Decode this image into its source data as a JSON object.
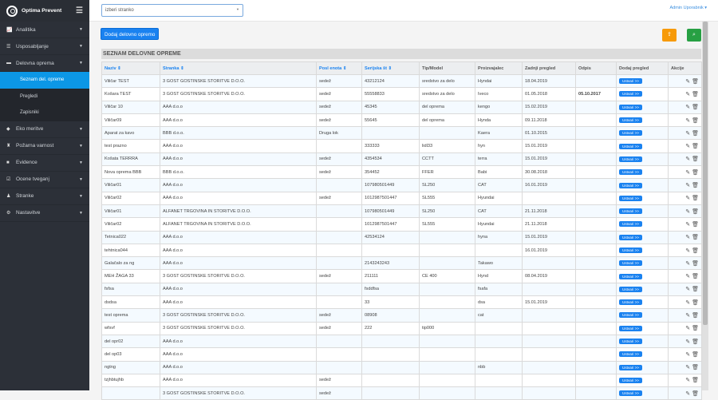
{
  "app": {
    "title": "Optima Prevent"
  },
  "sidebar": {
    "items": [
      {
        "label": "Analitika",
        "icon": "chart-icon",
        "glyph": "📈"
      },
      {
        "label": "Usposabljanje",
        "icon": "training-icon",
        "glyph": "☰"
      },
      {
        "label": "Delovna oprema",
        "icon": "truck-icon",
        "glyph": "▬"
      },
      {
        "label": "Eko meritve",
        "icon": "leaf-icon",
        "glyph": "◆"
      },
      {
        "label": "Požarna varnost",
        "icon": "fire-extinguisher-icon",
        "glyph": "♜"
      },
      {
        "label": "Evidence",
        "icon": "book-icon",
        "glyph": "■"
      },
      {
        "label": "Ocene tveganj",
        "icon": "checkbox-icon",
        "glyph": "☑"
      },
      {
        "label": "Stranke",
        "icon": "user-icon",
        "glyph": "♟"
      },
      {
        "label": "Nastavitve",
        "icon": "cogs-icon",
        "glyph": "⚙"
      }
    ],
    "sub": [
      "Seznam del. opreme",
      "Pregledi",
      "Zapisniki"
    ]
  },
  "topbar": {
    "select_value": "izberi stranko",
    "user": "Admin Uporabnik"
  },
  "main": {
    "add_button": "Dodaj delovno opremo",
    "section_title": "SEZNAM DELOVNE OPREME",
    "create_label": "Ustvari >>"
  },
  "table": {
    "columns": [
      "Naziv ⇕",
      "Stranka ⇕",
      "Posl enota ⇕",
      "Serijska št ⇕",
      "Tip/Model",
      "Proizvajalec",
      "Zadnji pregled",
      "Odpis",
      "Dodaj pregled",
      "Akcije"
    ],
    "rows": [
      [
        "Viličar TEST",
        "3 GOST GOSTINSKE STORITVE D.O.O.",
        "sedež",
        "43212124",
        "sredstvo za delo",
        "Hyndai",
        "18.04.2019",
        ""
      ],
      [
        "Košara TEST",
        "3 GOST GOSTINSKE STORITVE D.O.O.",
        "sedež",
        "55558833",
        "sredstvo za delo",
        "Iveco",
        "01.05.2018",
        "05.10.2017"
      ],
      [
        "Viličar 10",
        "AAA d.o.o",
        "sedež",
        "45345",
        "del oprema",
        "kengo",
        "15.02.2019",
        ""
      ],
      [
        "Viličar09",
        "AAA d.o.o",
        "sedež",
        "55645",
        "del oprema",
        "Hynda",
        "09.11.2018",
        ""
      ],
      [
        "Aparat za kavo",
        "BBB d.o.o.",
        "Druga lok",
        "",
        "",
        "Kaera",
        "01.10.2015",
        ""
      ],
      [
        "test prazno",
        "AAA d.o.o",
        "",
        "333333",
        "lidl33",
        "hyn",
        "15.01.2019",
        ""
      ],
      [
        "Košata TERRRA",
        "AAA d.o.o",
        "sedež",
        "4354534",
        "CCTT",
        "terra",
        "15.01.2019",
        ""
      ],
      [
        "Nova oprema BBB",
        "BBB d.o.o.",
        "sedež",
        "354452",
        "FFER",
        "Babi",
        "30.08.2018",
        ""
      ],
      [
        "Viličar01",
        "AAA d.o.o",
        "",
        "107980501449",
        "SL250",
        "CAT",
        "16.01.2019",
        ""
      ],
      [
        "Viličar02",
        "AAA d.o.o",
        "sedež",
        "1012987501447",
        "SL555",
        "Hyundai",
        "",
        ""
      ],
      [
        "Viličar01",
        "ALFANET TRGOVINA IN STORITVE D.O.O.",
        "",
        "107980501449",
        "SL250",
        "CAT",
        "21.11.2018",
        ""
      ],
      [
        "Viličar02",
        "ALFANET TRGOVINA IN STORITVE D.O.O.",
        "",
        "1012987501447",
        "SL555",
        "Hyundai",
        "21.11.2018",
        ""
      ],
      [
        "Tetnica022",
        "AAA d.o.o",
        "",
        "42534124",
        "",
        "hyna",
        "15.01.2019",
        ""
      ],
      [
        "tehtnica044",
        "AAA d.o.o",
        "",
        "",
        "",
        "",
        "16.01.2019",
        ""
      ],
      [
        "Galačalo za ng",
        "AAA d.o.o",
        "",
        "2143243243",
        "",
        "Takawo",
        "",
        ""
      ],
      [
        "MEH ŽAGA 33",
        "3 GOST GOSTINSKE STORITVE D.O.O.",
        "sedež",
        "211111",
        "CE 400",
        "Hynd",
        "08.04.2019",
        ""
      ],
      [
        "fsfsa",
        "AAA d.o.o",
        "",
        "fsddfsa",
        "",
        "fsafa",
        "",
        ""
      ],
      [
        "dsdsa",
        "AAA d.o.o",
        "",
        "33",
        "",
        "dsa",
        "15.01.2019",
        ""
      ],
      [
        "test oprema",
        "3 GOST GOSTINSKE STORITVE D.O.O.",
        "sedež",
        "08908",
        "",
        "cat",
        "",
        ""
      ],
      [
        "wfsvf",
        "3 GOST GOSTINSKE STORITVE D.O.O.",
        "sedež",
        "222",
        "tip000",
        "",
        "",
        ""
      ],
      [
        "del opr02",
        "AAA d.o.o",
        "",
        "",
        "",
        "",
        "",
        ""
      ],
      [
        "del op03",
        "AAA d.o.o",
        "",
        "",
        "",
        "",
        "",
        ""
      ],
      [
        "ngtng",
        "AAA d.o.o",
        "",
        "",
        "",
        "nbb",
        "",
        ""
      ],
      [
        "tzjhbtujhb",
        "AAA d.o.o",
        "sedež",
        "",
        "",
        "",
        "",
        ""
      ],
      [
        "",
        "3 GOST GOSTINSKE STORITVE D.O.O.",
        "sedež",
        "",
        "",
        "",
        "",
        ""
      ]
    ]
  }
}
